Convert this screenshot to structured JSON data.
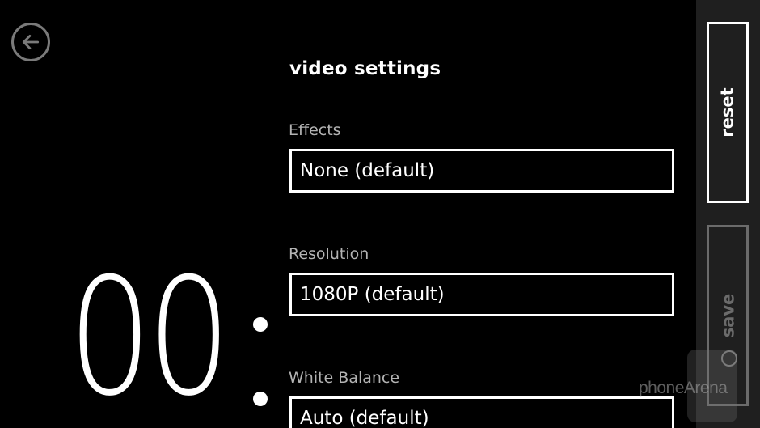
{
  "header": {
    "title": "video settings"
  },
  "timer": {
    "digits": "00"
  },
  "settings": [
    {
      "label": "Effects",
      "value": "None (default)"
    },
    {
      "label": "Resolution",
      "value": "1080P (default)"
    },
    {
      "label": "White Balance",
      "value": "Auto (default)"
    }
  ],
  "app_bar": {
    "reset_label": "reset",
    "save_label": "save"
  },
  "watermark": {
    "text": "phoneArena"
  },
  "icons": {
    "back": "back-arrow-icon"
  },
  "colors": {
    "background": "#000000",
    "app_bar": "#1f1f1f",
    "label_gray": "#b3b3b3",
    "disabled_gray": "#6b6b6b"
  }
}
